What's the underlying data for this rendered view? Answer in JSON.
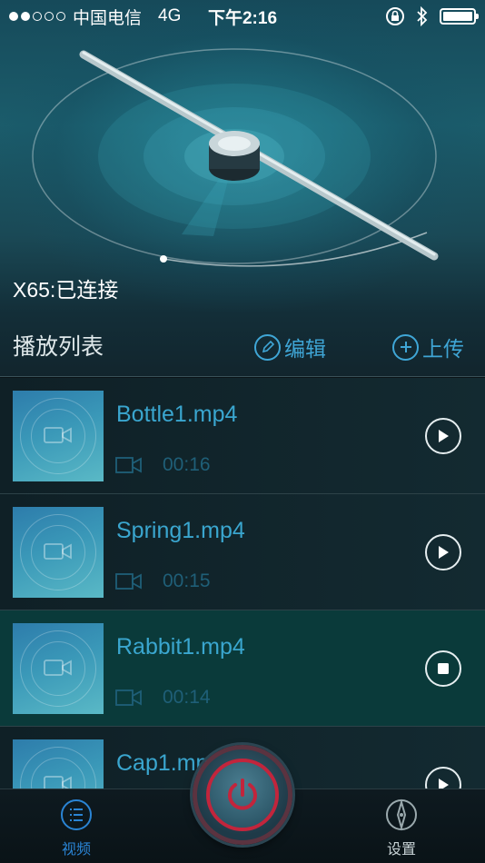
{
  "status_bar": {
    "carrier": "中国电信",
    "network": "4G",
    "time": "下午2:16",
    "icons": [
      "signal-dots",
      "orientation-lock-icon",
      "bluetooth-icon",
      "battery-icon"
    ]
  },
  "device": {
    "status": "X65:已连接"
  },
  "playlist": {
    "title": "播放列表",
    "edit_label": "编辑",
    "upload_label": "上传",
    "items": [
      {
        "name": "Bottle1.mp4",
        "duration": "00:16",
        "state": "play"
      },
      {
        "name": "Spring1.mp4",
        "duration": "00:15",
        "state": "play"
      },
      {
        "name": "Rabbit1.mp4",
        "duration": "00:14",
        "state": "stop"
      },
      {
        "name": "Cap1.mp4",
        "duration": "",
        "state": "play"
      }
    ]
  },
  "tabs": {
    "video_label": "视频",
    "settings_label": "设置"
  },
  "colors": {
    "accent": "#3fa6d6",
    "active_row": "#0a3a3a",
    "power_ring": "#c2253c"
  }
}
